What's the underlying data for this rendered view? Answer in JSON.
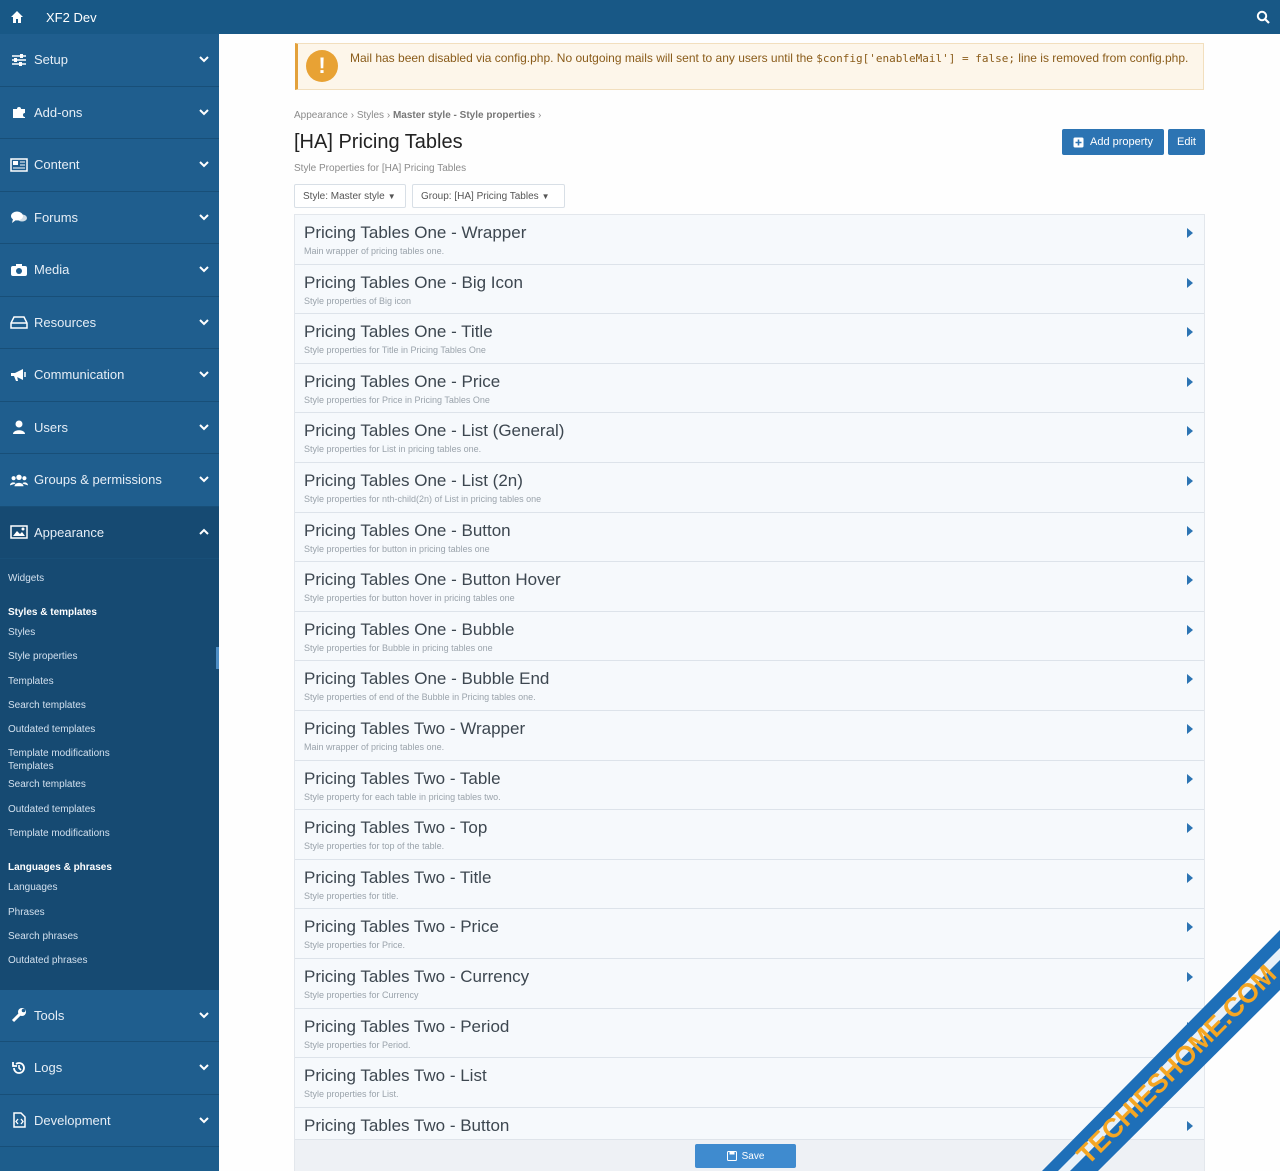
{
  "topbar": {
    "title": "XF2 Dev"
  },
  "sidebar": {
    "items": [
      {
        "label": "Setup",
        "icon": "sliders-icon"
      },
      {
        "label": "Add-ons",
        "icon": "puzzle-icon"
      },
      {
        "label": "Content",
        "icon": "newspaper-icon"
      },
      {
        "label": "Forums",
        "icon": "comments-icon"
      },
      {
        "label": "Media",
        "icon": "camera-icon"
      },
      {
        "label": "Resources",
        "icon": "drive-icon"
      },
      {
        "label": "Communication",
        "icon": "megaphone-icon"
      },
      {
        "label": "Users",
        "icon": "user-icon"
      },
      {
        "label": "Groups & permissions",
        "icon": "users-icon"
      },
      {
        "label": "Appearance",
        "icon": "image-icon"
      }
    ],
    "appearance_sub": {
      "widgets": "Widgets",
      "styles_head": "Styles & templates",
      "links1": [
        "Styles",
        "Style properties",
        "Templates",
        "Search templates",
        "Outdated templates"
      ],
      "template_mod_templates": "Template modifications Templates",
      "links2": [
        "Search templates",
        "Outdated templates",
        "Template modifications"
      ],
      "lang_head": "Languages & phrases",
      "links3": [
        "Languages",
        "Phrases",
        "Search phrases",
        "Outdated phrases"
      ]
    },
    "bottom_items": [
      {
        "label": "Tools",
        "icon": "wrench-icon"
      },
      {
        "label": "Logs",
        "icon": "history-icon"
      },
      {
        "label": "Development",
        "icon": "code-icon"
      }
    ]
  },
  "notice": {
    "part1": "Mail has been disabled via config.php. No outgoing mails will sent to any users until the ",
    "code": "$config['enableMail'] = false;",
    "part2": " line is removed from config.php."
  },
  "breadcrumb": {
    "a": "Appearance",
    "b": "Styles",
    "c": "Master style - Style properties"
  },
  "page": {
    "title": "[HA] Pricing Tables",
    "description": "Style Properties for [HA] Pricing Tables",
    "add_property": "Add property",
    "edit": "Edit",
    "style_filter": "Style: Master style",
    "group_filter": "Group: [HA] Pricing Tables"
  },
  "rows": [
    {
      "title": "Pricing Tables One - Wrapper",
      "desc": "Main wrapper of pricing tables one."
    },
    {
      "title": "Pricing Tables One - Big Icon",
      "desc": "Style properties of Big icon"
    },
    {
      "title": "Pricing Tables One - Title",
      "desc": "Style properties for Title in Pricing Tables One"
    },
    {
      "title": "Pricing Tables One - Price",
      "desc": "Style properties for Price in Pricing Tables One"
    },
    {
      "title": "Pricing Tables One - List (General)",
      "desc": "Style properties for List in pricing tables one."
    },
    {
      "title": "Pricing Tables One - List (2n)",
      "desc": "Style properties for nth-child(2n) of List in pricing tables one"
    },
    {
      "title": "Pricing Tables One - Button",
      "desc": "Style properties for button in pricing tables one"
    },
    {
      "title": "Pricing Tables One - Button Hover",
      "desc": "Style properties for button hover in pricing tables one"
    },
    {
      "title": "Pricing Tables One - Bubble",
      "desc": "Style properties for Bubble in pricing tables one"
    },
    {
      "title": "Pricing Tables One - Bubble End",
      "desc": "Style properties of end of the Bubble in Pricing tables one."
    },
    {
      "title": "Pricing Tables Two - Wrapper",
      "desc": "Main wrapper of pricing tables one."
    },
    {
      "title": "Pricing Tables Two - Table",
      "desc": "Style property for each table in pricing tables two."
    },
    {
      "title": "Pricing Tables Two - Top",
      "desc": "Style properties for top of the table."
    },
    {
      "title": "Pricing Tables Two - Title",
      "desc": "Style properties for title."
    },
    {
      "title": "Pricing Tables Two - Price",
      "desc": "Style properties for Price."
    },
    {
      "title": "Pricing Tables Two - Currency",
      "desc": "Style properties for Currency"
    },
    {
      "title": "Pricing Tables Two - Period",
      "desc": "Style properties for Period."
    },
    {
      "title": "Pricing Tables Two - List",
      "desc": "Style properties for List."
    },
    {
      "title": "Pricing Tables Two - Button",
      "desc": ""
    }
  ],
  "save_label": "Save",
  "watermark": "TECHIESHOME.COM",
  "colors": {
    "header": "#185886",
    "sidebar": "#1d5d8c",
    "accent": "#2c74b3",
    "warning": "#e8a234"
  }
}
